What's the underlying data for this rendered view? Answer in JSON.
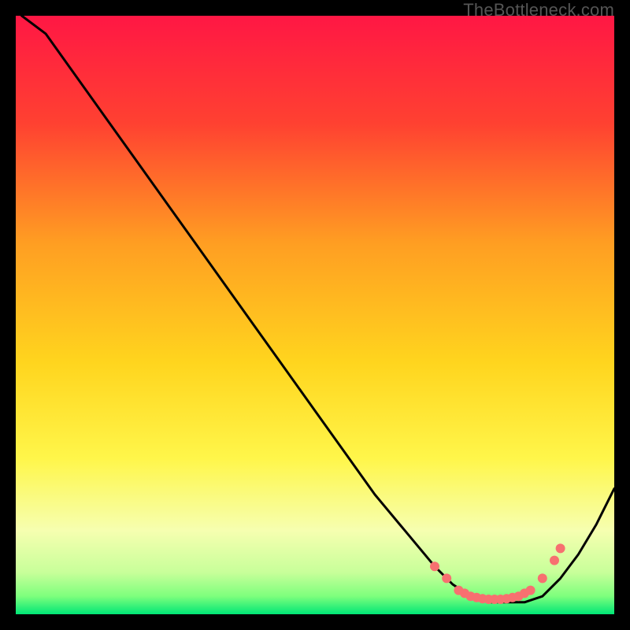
{
  "watermark": "TheBottleneck.com",
  "chart_data": {
    "type": "line",
    "title": "",
    "xlabel": "",
    "ylabel": "",
    "xlim": [
      0,
      100
    ],
    "ylim": [
      0,
      100
    ],
    "series": [
      {
        "name": "curve",
        "x": [
          1,
          5,
          10,
          15,
          20,
          25,
          30,
          35,
          40,
          45,
          50,
          55,
          60,
          65,
          70,
          73,
          76,
          79,
          82,
          85,
          88,
          91,
          94,
          97,
          100
        ],
        "y": [
          100,
          97,
          90,
          83,
          76,
          69,
          62,
          55,
          48,
          41,
          34,
          27,
          20,
          14,
          8,
          5,
          3,
          2,
          2,
          2,
          3,
          6,
          10,
          15,
          21
        ]
      }
    ],
    "markers": {
      "name": "highlighted-points",
      "x": [
        70,
        72,
        74,
        75,
        76,
        77,
        78,
        79,
        80,
        81,
        82,
        83,
        84,
        85,
        86,
        88,
        90,
        91
      ],
      "y": [
        8,
        6,
        4,
        3.5,
        3,
        2.8,
        2.6,
        2.5,
        2.5,
        2.5,
        2.6,
        2.8,
        3,
        3.5,
        4,
        6,
        9,
        11
      ]
    },
    "gradient_bands": [
      {
        "y_from": 100,
        "y_to": 82,
        "color_from": "#ff1744",
        "color_to": "#ff5131"
      },
      {
        "y_from": 82,
        "y_to": 62,
        "color_from": "#ff5131",
        "color_to": "#ff9e22"
      },
      {
        "y_from": 62,
        "y_to": 42,
        "color_from": "#ff9e22",
        "color_to": "#ffd51e"
      },
      {
        "y_from": 42,
        "y_to": 22,
        "color_from": "#ffd51e",
        "color_to": "#fff64a"
      },
      {
        "y_from": 22,
        "y_to": 10,
        "color_from": "#fff64a",
        "color_to": "#f2ff8a"
      },
      {
        "y_from": 10,
        "y_to": 4,
        "color_from": "#f2ff8a",
        "color_to": "#b7ff8a"
      },
      {
        "y_from": 4,
        "y_to": 0,
        "color_from": "#6fff6f",
        "color_to": "#00e676"
      }
    ],
    "curve_color": "#000000",
    "marker_color": "#f77070"
  }
}
